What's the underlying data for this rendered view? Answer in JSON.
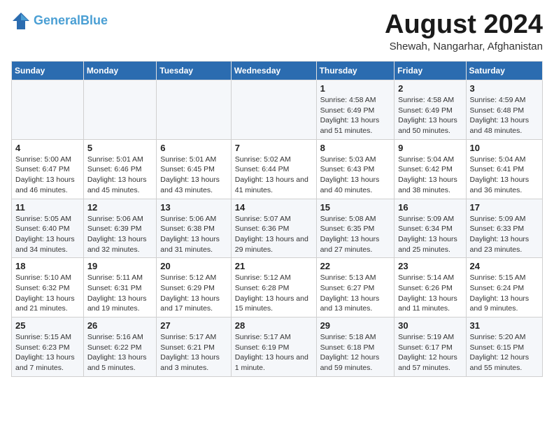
{
  "header": {
    "logo_line1": "General",
    "logo_line2": "Blue",
    "month_year": "August 2024",
    "location": "Shewah, Nangarhar, Afghanistan"
  },
  "weekdays": [
    "Sunday",
    "Monday",
    "Tuesday",
    "Wednesday",
    "Thursday",
    "Friday",
    "Saturday"
  ],
  "weeks": [
    [
      {
        "day": "",
        "info": ""
      },
      {
        "day": "",
        "info": ""
      },
      {
        "day": "",
        "info": ""
      },
      {
        "day": "",
        "info": ""
      },
      {
        "day": "1",
        "info": "Sunrise: 4:58 AM\nSunset: 6:49 PM\nDaylight: 13 hours\nand 51 minutes."
      },
      {
        "day": "2",
        "info": "Sunrise: 4:58 AM\nSunset: 6:49 PM\nDaylight: 13 hours\nand 50 minutes."
      },
      {
        "day": "3",
        "info": "Sunrise: 4:59 AM\nSunset: 6:48 PM\nDaylight: 13 hours\nand 48 minutes."
      }
    ],
    [
      {
        "day": "4",
        "info": "Sunrise: 5:00 AM\nSunset: 6:47 PM\nDaylight: 13 hours\nand 46 minutes."
      },
      {
        "day": "5",
        "info": "Sunrise: 5:01 AM\nSunset: 6:46 PM\nDaylight: 13 hours\nand 45 minutes."
      },
      {
        "day": "6",
        "info": "Sunrise: 5:01 AM\nSunset: 6:45 PM\nDaylight: 13 hours\nand 43 minutes."
      },
      {
        "day": "7",
        "info": "Sunrise: 5:02 AM\nSunset: 6:44 PM\nDaylight: 13 hours\nand 41 minutes."
      },
      {
        "day": "8",
        "info": "Sunrise: 5:03 AM\nSunset: 6:43 PM\nDaylight: 13 hours\nand 40 minutes."
      },
      {
        "day": "9",
        "info": "Sunrise: 5:04 AM\nSunset: 6:42 PM\nDaylight: 13 hours\nand 38 minutes."
      },
      {
        "day": "10",
        "info": "Sunrise: 5:04 AM\nSunset: 6:41 PM\nDaylight: 13 hours\nand 36 minutes."
      }
    ],
    [
      {
        "day": "11",
        "info": "Sunrise: 5:05 AM\nSunset: 6:40 PM\nDaylight: 13 hours\nand 34 minutes."
      },
      {
        "day": "12",
        "info": "Sunrise: 5:06 AM\nSunset: 6:39 PM\nDaylight: 13 hours\nand 32 minutes."
      },
      {
        "day": "13",
        "info": "Sunrise: 5:06 AM\nSunset: 6:38 PM\nDaylight: 13 hours\nand 31 minutes."
      },
      {
        "day": "14",
        "info": "Sunrise: 5:07 AM\nSunset: 6:36 PM\nDaylight: 13 hours\nand 29 minutes."
      },
      {
        "day": "15",
        "info": "Sunrise: 5:08 AM\nSunset: 6:35 PM\nDaylight: 13 hours\nand 27 minutes."
      },
      {
        "day": "16",
        "info": "Sunrise: 5:09 AM\nSunset: 6:34 PM\nDaylight: 13 hours\nand 25 minutes."
      },
      {
        "day": "17",
        "info": "Sunrise: 5:09 AM\nSunset: 6:33 PM\nDaylight: 13 hours\nand 23 minutes."
      }
    ],
    [
      {
        "day": "18",
        "info": "Sunrise: 5:10 AM\nSunset: 6:32 PM\nDaylight: 13 hours\nand 21 minutes."
      },
      {
        "day": "19",
        "info": "Sunrise: 5:11 AM\nSunset: 6:31 PM\nDaylight: 13 hours\nand 19 minutes."
      },
      {
        "day": "20",
        "info": "Sunrise: 5:12 AM\nSunset: 6:29 PM\nDaylight: 13 hours\nand 17 minutes."
      },
      {
        "day": "21",
        "info": "Sunrise: 5:12 AM\nSunset: 6:28 PM\nDaylight: 13 hours\nand 15 minutes."
      },
      {
        "day": "22",
        "info": "Sunrise: 5:13 AM\nSunset: 6:27 PM\nDaylight: 13 hours\nand 13 minutes."
      },
      {
        "day": "23",
        "info": "Sunrise: 5:14 AM\nSunset: 6:26 PM\nDaylight: 13 hours\nand 11 minutes."
      },
      {
        "day": "24",
        "info": "Sunrise: 5:15 AM\nSunset: 6:24 PM\nDaylight: 13 hours\nand 9 minutes."
      }
    ],
    [
      {
        "day": "25",
        "info": "Sunrise: 5:15 AM\nSunset: 6:23 PM\nDaylight: 13 hours\nand 7 minutes."
      },
      {
        "day": "26",
        "info": "Sunrise: 5:16 AM\nSunset: 6:22 PM\nDaylight: 13 hours\nand 5 minutes."
      },
      {
        "day": "27",
        "info": "Sunrise: 5:17 AM\nSunset: 6:21 PM\nDaylight: 13 hours\nand 3 minutes."
      },
      {
        "day": "28",
        "info": "Sunrise: 5:17 AM\nSunset: 6:19 PM\nDaylight: 13 hours\nand 1 minute."
      },
      {
        "day": "29",
        "info": "Sunrise: 5:18 AM\nSunset: 6:18 PM\nDaylight: 12 hours\nand 59 minutes."
      },
      {
        "day": "30",
        "info": "Sunrise: 5:19 AM\nSunset: 6:17 PM\nDaylight: 12 hours\nand 57 minutes."
      },
      {
        "day": "31",
        "info": "Sunrise: 5:20 AM\nSunset: 6:15 PM\nDaylight: 12 hours\nand 55 minutes."
      }
    ]
  ]
}
